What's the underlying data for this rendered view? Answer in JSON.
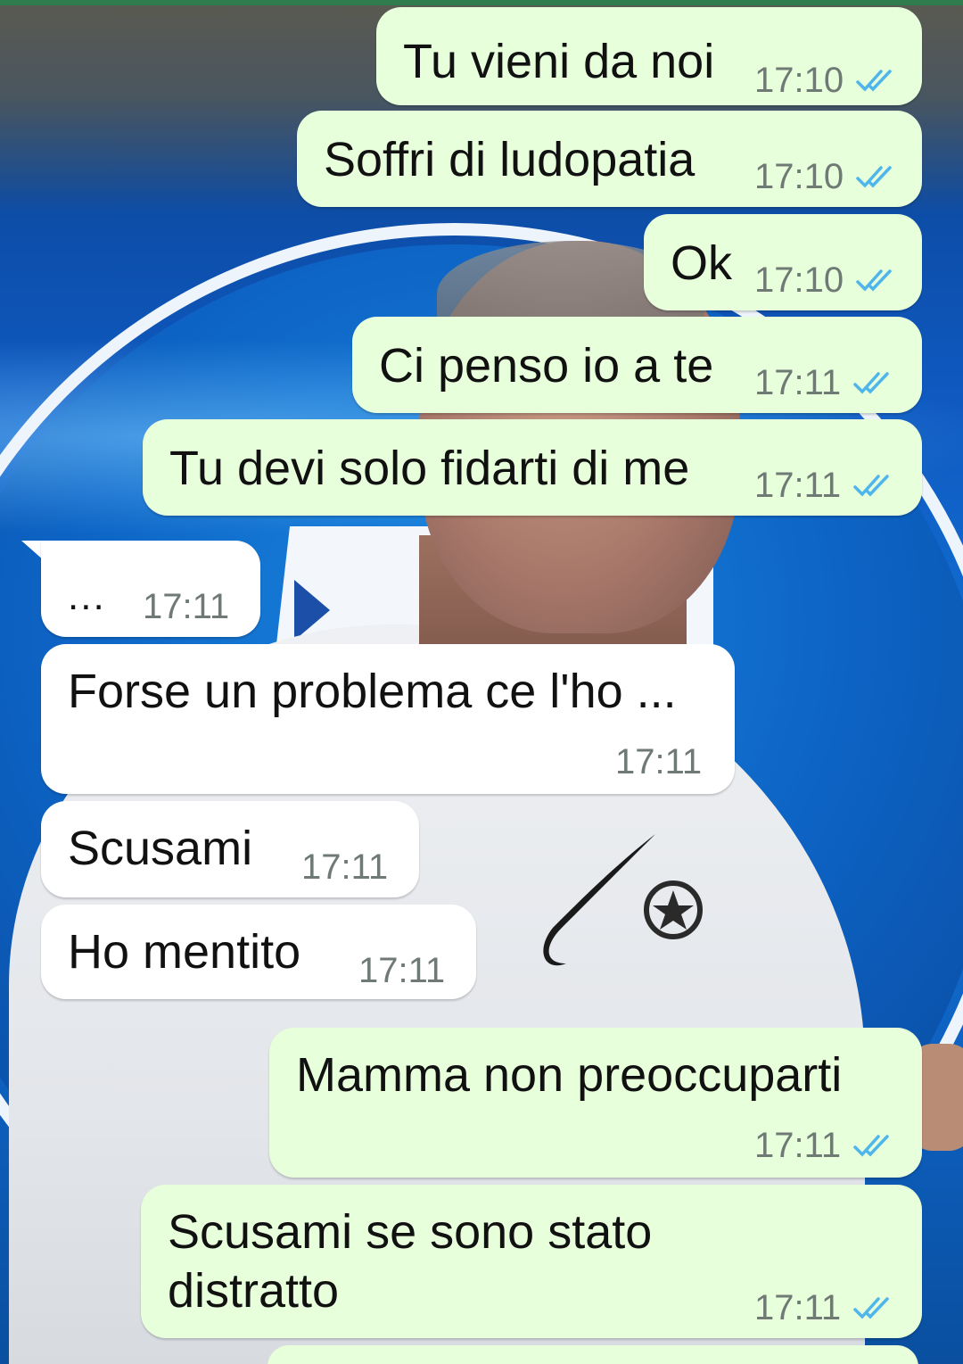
{
  "colors": {
    "outgoing_bubble": "#e7ffdb",
    "incoming_bubble": "#ffffff",
    "timestamp": "#6f7a75",
    "read_ticks": "#4fb6ec",
    "wallpaper_blue": "#0f5ac2"
  },
  "messages": [
    {
      "direction": "outgoing",
      "text": "Tu vieni da noi",
      "time": "17:10",
      "status": "read"
    },
    {
      "direction": "outgoing",
      "text": "Soffri di ludopatia",
      "time": "17:10",
      "status": "read"
    },
    {
      "direction": "outgoing",
      "text": "Ok",
      "time": "17:10",
      "status": "read"
    },
    {
      "direction": "outgoing",
      "text": "Ci penso io a te",
      "time": "17:11",
      "status": "read"
    },
    {
      "direction": "outgoing",
      "text": "Tu devi solo fidarti di me",
      "time": "17:11",
      "status": "read"
    },
    {
      "direction": "incoming",
      "text": "...",
      "time": "17:11"
    },
    {
      "direction": "incoming",
      "text": "Forse un problema ce l'ho ...",
      "time": "17:11"
    },
    {
      "direction": "incoming",
      "text": "Scusami",
      "time": "17:11"
    },
    {
      "direction": "incoming",
      "text": "Ho mentito",
      "time": "17:11"
    },
    {
      "direction": "outgoing",
      "text": "Mamma non preoccuparti",
      "time": "17:11",
      "status": "read"
    },
    {
      "direction": "outgoing",
      "text_lines": [
        "Scusami se sono stato",
        "distratto"
      ],
      "time": "17:11",
      "status": "read"
    }
  ],
  "icons": {
    "read_receipt": "double-check-icon"
  }
}
